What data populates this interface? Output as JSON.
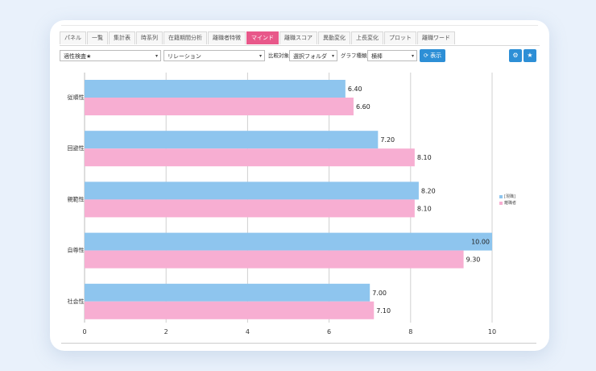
{
  "tabs": [
    "パネル",
    "一覧",
    "集計表",
    "時系列",
    "在籍期間分析",
    "離職者特徴",
    "マインド",
    "離職スコア",
    "異動変化",
    "上長変化",
    "プロット",
    "離職ワード"
  ],
  "active_tab_index": 6,
  "toolbar": {
    "select1": "適性検査★",
    "select2": "リレーション",
    "compare_label": "比較対象",
    "compare_select": "選択フォルダ",
    "graph_type_label": "グラフ種類",
    "graph_type_select": "横棒",
    "show_button": "表示",
    "settings_icon": "gear-icon",
    "star_icon": "star-icon"
  },
  "legend": [
    "[現職]",
    "離職者"
  ],
  "colors": {
    "current": "#8ec5ee",
    "left": "#f7aed2",
    "accent": "#e8588a",
    "button": "#2d8fd6"
  },
  "chart_data": {
    "type": "bar",
    "orientation": "horizontal",
    "categories": [
      "従順性",
      "回避性",
      "親範性",
      "自尊性",
      "社会性"
    ],
    "series": [
      {
        "name": "[現職]",
        "values": [
          6.4,
          7.2,
          8.2,
          10.0,
          7.0
        ]
      },
      {
        "name": "離職者",
        "values": [
          6.6,
          8.1,
          8.1,
          9.3,
          7.1
        ]
      }
    ],
    "data_labels": [
      [
        "6.40",
        "6.60"
      ],
      [
        "7.20",
        "8.10"
      ],
      [
        "8.20",
        "8.10"
      ],
      [
        "10.00",
        "9.30"
      ],
      [
        "7.00",
        "7.10"
      ]
    ],
    "xticks": [
      "0",
      "2",
      "4",
      "6",
      "8",
      "10"
    ],
    "xlim": [
      0,
      11
    ],
    "grid": true,
    "legend_position": "right"
  }
}
